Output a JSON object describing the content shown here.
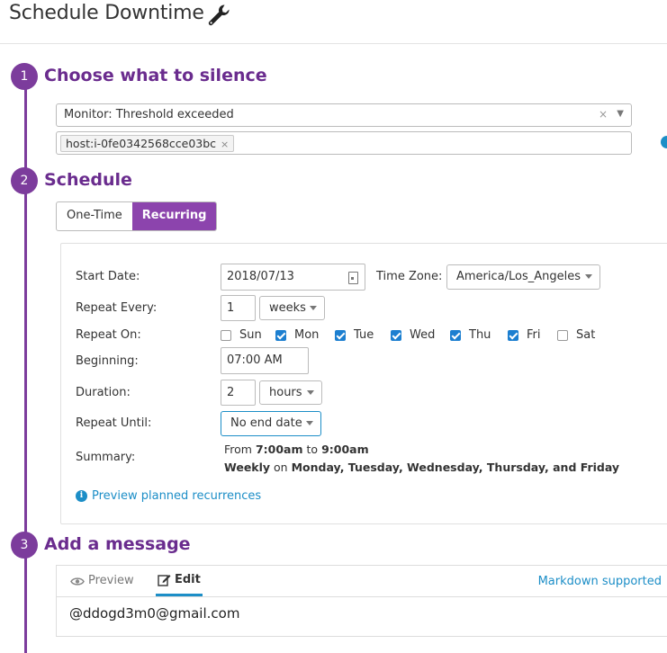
{
  "header": {
    "title": "Schedule Downtime",
    "icon": "wrench-icon"
  },
  "steps": [
    {
      "number": "1",
      "title": "Choose what to silence"
    },
    {
      "number": "2",
      "title": "Schedule"
    },
    {
      "number": "3",
      "title": "Add a message"
    }
  ],
  "silence": {
    "monitor_value": "Monitor: Threshold exceeded",
    "clear": "×",
    "tag": "host:i-0fe0342568cce03bc",
    "tag_remove": "×"
  },
  "schedule": {
    "toggle": {
      "one_time": "One-Time",
      "recurring": "Recurring",
      "active": "Recurring"
    },
    "start_date_label": "Start Date:",
    "start_date": "2018/07/13",
    "timezone_label": "Time Zone:",
    "timezone": "America/Los_Angeles",
    "repeat_every_label": "Repeat Every:",
    "repeat_every_value": "1",
    "repeat_every_unit": "weeks",
    "repeat_on_label": "Repeat On:",
    "days": [
      {
        "label": "Sun",
        "checked": false
      },
      {
        "label": "Mon",
        "checked": true
      },
      {
        "label": "Tue",
        "checked": true
      },
      {
        "label": "Wed",
        "checked": true
      },
      {
        "label": "Thu",
        "checked": true
      },
      {
        "label": "Fri",
        "checked": true
      },
      {
        "label": "Sat",
        "checked": false
      }
    ],
    "beginning_label": "Beginning:",
    "beginning": "07:00 AM",
    "duration_label": "Duration:",
    "duration_value": "2",
    "duration_unit": "hours",
    "repeat_until_label": "Repeat Until:",
    "repeat_until": "No end date",
    "summary_label": "Summary:",
    "summary": {
      "from_word": "From",
      "start": "7:00am",
      "to_word": "to",
      "end": "9:00am",
      "freq": "Weekly",
      "on_word": "on",
      "days_text": "Monday, Tuesday, Wednesday, Thursday, and Friday"
    },
    "preview_link": "Preview planned recurrences"
  },
  "message": {
    "tab_preview": "Preview",
    "tab_edit": "Edit",
    "markdown_link": "Markdown supported",
    "text": "@ddogd3m0@gmail.com"
  },
  "colors": {
    "accent_purple": "#7c3c9c",
    "link_blue": "#1c8ec7",
    "checkbox_blue": "#1c7fd0"
  }
}
